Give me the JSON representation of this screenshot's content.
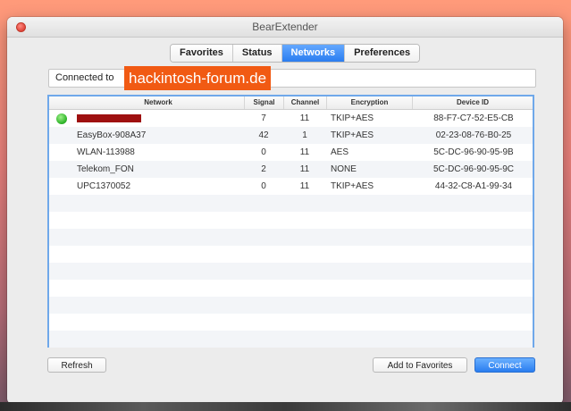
{
  "window": {
    "title": "BearExtender"
  },
  "tabs": [
    {
      "label": "Favorites"
    },
    {
      "label": "Status"
    },
    {
      "label": "Networks",
      "active": true
    },
    {
      "label": "Preferences"
    }
  ],
  "connection": {
    "label": "Connected to",
    "value": "hackintosh-forum.de"
  },
  "table": {
    "columns": [
      "Network",
      "Signal",
      "Channel",
      "Encryption",
      "Device ID"
    ],
    "rows": [
      {
        "network": "",
        "redacted": true,
        "connected": true,
        "signal": "7",
        "channel": "11",
        "encryption": "TKIP+AES",
        "device_id": "88-F7-C7-52-E5-CB"
      },
      {
        "network": "EasyBox-908A37",
        "signal": "42",
        "channel": "1",
        "encryption": "TKIP+AES",
        "device_id": "02-23-08-76-B0-25"
      },
      {
        "network": "WLAN-113988",
        "signal": "0",
        "channel": "11",
        "encryption": "AES",
        "device_id": "5C-DC-96-90-95-9B"
      },
      {
        "network": "Telekom_FON",
        "signal": "2",
        "channel": "11",
        "encryption": "NONE",
        "device_id": "5C-DC-96-90-95-9C"
      },
      {
        "network": "UPC1370052",
        "signal": "0",
        "channel": "11",
        "encryption": "TKIP+AES",
        "device_id": "44-32-C8-A1-99-34"
      }
    ]
  },
  "buttons": {
    "refresh": "Refresh",
    "add_favorites": "Add to Favorites",
    "connect": "Connect"
  },
  "colors": {
    "accent": "#2a7df0",
    "highlight": "#f15a13",
    "connected": "#2fb52a"
  }
}
